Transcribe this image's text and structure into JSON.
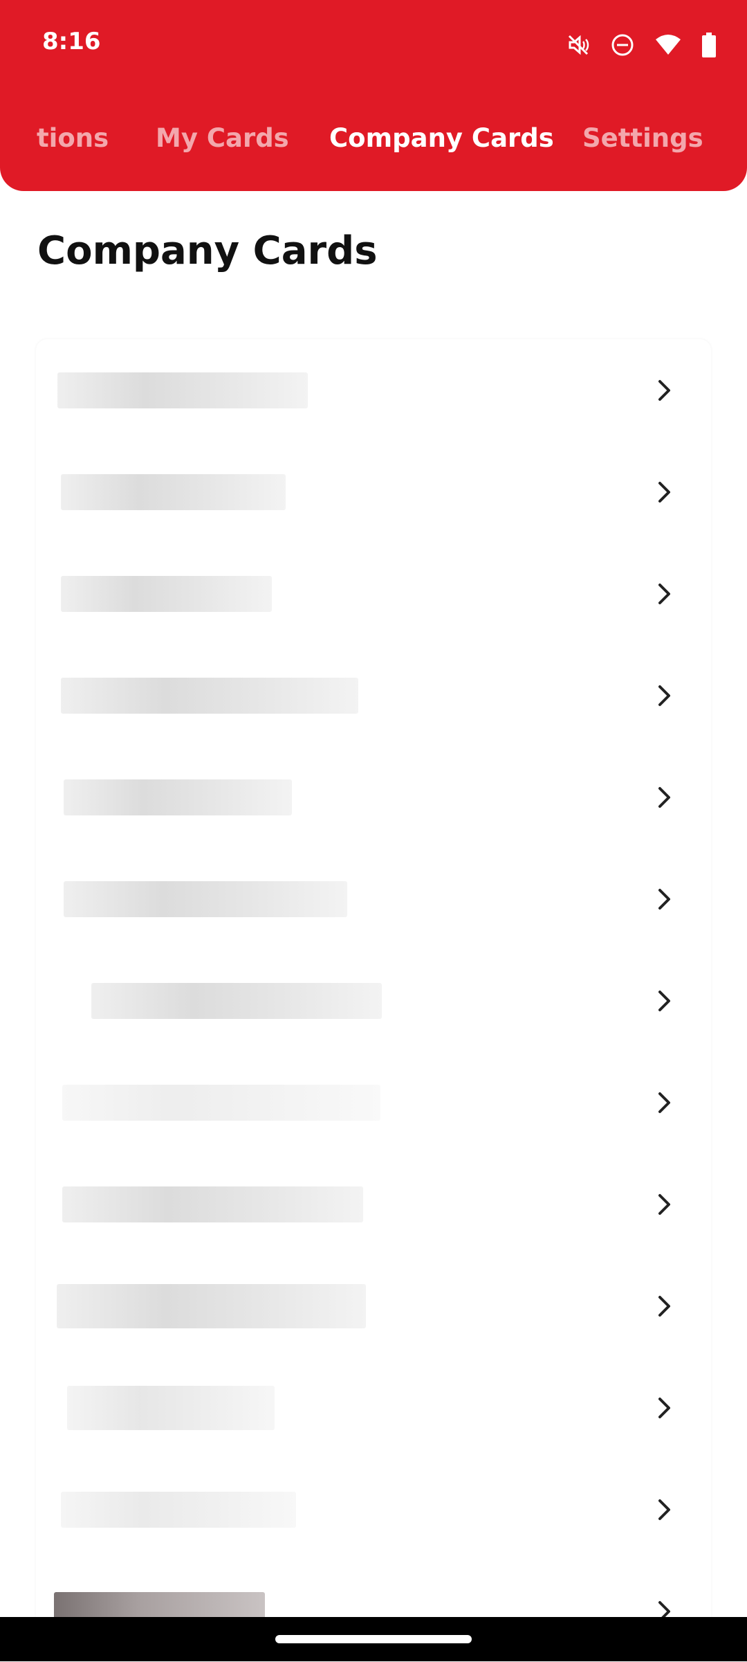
{
  "status_bar": {
    "time": "8:16",
    "icons": [
      "mute-icon",
      "dnd-icon",
      "wifi-icon",
      "battery-icon"
    ]
  },
  "tabs": [
    {
      "label": "tions",
      "active": false
    },
    {
      "label": "My Cards",
      "active": false
    },
    {
      "label": "Company Cards",
      "active": true
    },
    {
      "label": "Settings",
      "active": false
    }
  ],
  "page": {
    "title": "Company Cards"
  },
  "company_cards": {
    "rows_count": 13,
    "row_icon": "chevron-right-icon"
  },
  "colors": {
    "brand_red": "#E01A26",
    "text": "#111111"
  }
}
